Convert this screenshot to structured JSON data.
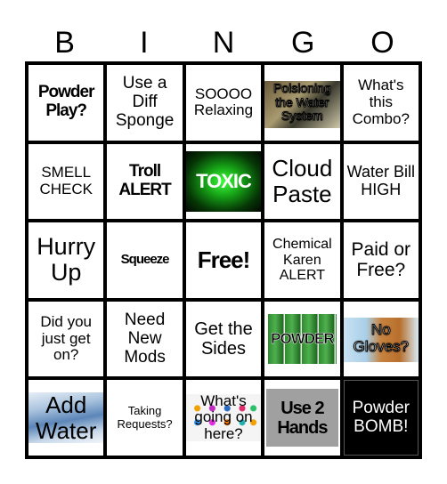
{
  "header": {
    "letters": [
      "B",
      "I",
      "N",
      "G",
      "O"
    ]
  },
  "cells": [
    {
      "text": "Powder Play?"
    },
    {
      "text": "Use a Diff Sponge"
    },
    {
      "text": "SOOOO Relaxing"
    },
    {
      "text": "Poisioning the Water System"
    },
    {
      "text": "What's this Combo?"
    },
    {
      "text": "SMELL CHECK"
    },
    {
      "text": "Troll ALERT"
    },
    {
      "text": "TOXIC"
    },
    {
      "text": "Cloud Paste"
    },
    {
      "text": "Water Bill HIGH"
    },
    {
      "text": "Hurry Up"
    },
    {
      "text": "Squeeze"
    },
    {
      "text": "Free!"
    },
    {
      "text": "Chemical Karen ALERT"
    },
    {
      "text": "Paid or Free?"
    },
    {
      "text": "Did you just get on?"
    },
    {
      "text": "Need New Mods"
    },
    {
      "text": "Get the Sides"
    },
    {
      "text": "POWDER"
    },
    {
      "text": "No Gloves?"
    },
    {
      "text": "Add Water"
    },
    {
      "text": "Taking Requests?"
    },
    {
      "text": "What's going on here?"
    },
    {
      "text": "Use 2 Hands"
    },
    {
      "text": "Powder BOMB!"
    }
  ],
  "colors": {
    "toxic_green": "#22c922",
    "free_space_bg": "#000000",
    "hands_bg": "#a0a0a0"
  }
}
